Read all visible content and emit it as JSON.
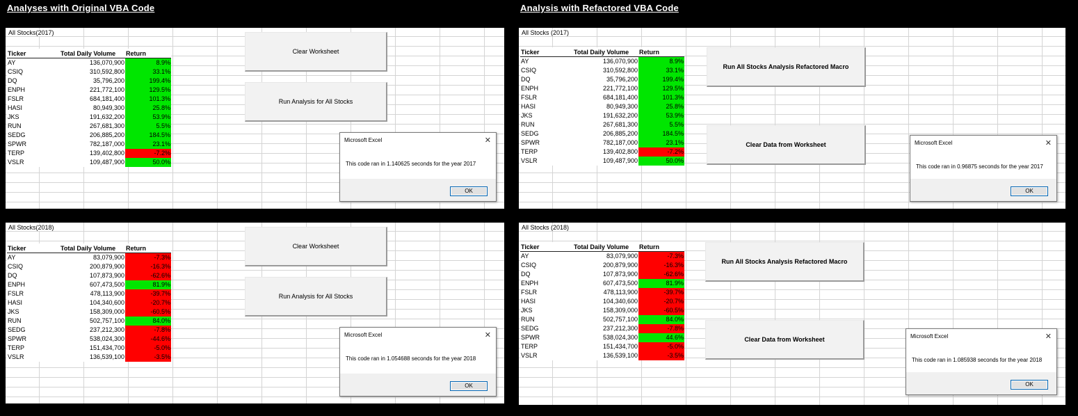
{
  "headings": {
    "original": "Analyses with Original VBA Code",
    "refactored": "Analysis with Refactored VBA Code"
  },
  "colors": {
    "positive": "#00e600",
    "negative": "#ff0000"
  },
  "panels": {
    "orig2017": {
      "title": "All Stocks(2017)",
      "headers": [
        "Ticker",
        "Total Daily Volume",
        "Return"
      ],
      "rows": [
        [
          "AY",
          "136,070,900",
          "8.9%"
        ],
        [
          "CSIQ",
          "310,592,800",
          "33.1%"
        ],
        [
          "DQ",
          "35,796,200",
          "199.4%"
        ],
        [
          "ENPH",
          "221,772,100",
          "129.5%"
        ],
        [
          "FSLR",
          "684,181,400",
          "101.3%"
        ],
        [
          "HASI",
          "80,949,300",
          "25.8%"
        ],
        [
          "JKS",
          "191,632,200",
          "53.9%"
        ],
        [
          "RUN",
          "267,681,300",
          "5.5%"
        ],
        [
          "SEDG",
          "206,885,200",
          "184.5%"
        ],
        [
          "SPWR",
          "782,187,000",
          "23.1%"
        ],
        [
          "TERP",
          "139,402,800",
          "-7.2%"
        ],
        [
          "VSLR",
          "109,487,900",
          "50.0%"
        ]
      ],
      "button1": "Clear Worksheet",
      "button2": "Run Analysis for All Stocks",
      "dialog": {
        "title": "Microsoft Excel",
        "message": "This code ran in 1.140625 seconds for the year 2017",
        "ok": "OK"
      }
    },
    "orig2018": {
      "title": "All Stocks(2018)",
      "headers": [
        "Ticker",
        "Total Daily Volume",
        "Return"
      ],
      "rows": [
        [
          "AY",
          "83,079,900",
          "-7.3%"
        ],
        [
          "CSIQ",
          "200,879,900",
          "-16.3%"
        ],
        [
          "DQ",
          "107,873,900",
          "-62.6%"
        ],
        [
          "ENPH",
          "607,473,500",
          "81.9%"
        ],
        [
          "FSLR",
          "478,113,900",
          "-39.7%"
        ],
        [
          "HASI",
          "104,340,600",
          "-20.7%"
        ],
        [
          "JKS",
          "158,309,000",
          "-60.5%"
        ],
        [
          "RUN",
          "502,757,100",
          "84.0%"
        ],
        [
          "SEDG",
          "237,212,300",
          "-7.8%"
        ],
        [
          "SPWR",
          "538,024,300",
          "-44.6%"
        ],
        [
          "TERP",
          "151,434,700",
          "-5.0%"
        ],
        [
          "VSLR",
          "136,539,100",
          "-3.5%"
        ]
      ],
      "button1": "Clear Worksheet",
      "button2": "Run Analysis for All Stocks",
      "dialog": {
        "title": "Microsoft Excel",
        "message": "This code ran in 1.054688 seconds for the year 2018",
        "ok": "OK"
      }
    },
    "ref2017": {
      "title": "All Stocks (2017)",
      "headers": [
        "Ticker",
        "Total Daily Volume",
        "Return"
      ],
      "rows": [
        [
          "AY",
          "136,070,900",
          "8.9%"
        ],
        [
          "CSIQ",
          "310,592,800",
          "33.1%"
        ],
        [
          "DQ",
          "35,796,200",
          "199.4%"
        ],
        [
          "ENPH",
          "221,772,100",
          "129.5%"
        ],
        [
          "FSLR",
          "684,181,400",
          "101.3%"
        ],
        [
          "HASI",
          "80,949,300",
          "25.8%"
        ],
        [
          "JKS",
          "191,632,200",
          "53.9%"
        ],
        [
          "RUN",
          "267,681,300",
          "5.5%"
        ],
        [
          "SEDG",
          "206,885,200",
          "184.5%"
        ],
        [
          "SPWR",
          "782,187,000",
          "23.1%"
        ],
        [
          "TERP",
          "139,402,800",
          "-7.2%"
        ],
        [
          "VSLR",
          "109,487,900",
          "50.0%"
        ]
      ],
      "button1": "Run All Stocks Analysis Refactored Macro",
      "button2": "Clear Data from Worksheet",
      "dialog": {
        "title": "Microsoft Excel",
        "message": "This code ran in 0.96875 seconds for the year 2017",
        "ok": "OK"
      }
    },
    "ref2018": {
      "title": "All Stocks (2018)",
      "headers": [
        "Ticker",
        "Total Daily Volume",
        "Return"
      ],
      "rows": [
        [
          "AY",
          "83,079,900",
          "-7.3%"
        ],
        [
          "CSIQ",
          "200,879,900",
          "-16.3%"
        ],
        [
          "DQ",
          "107,873,900",
          "-62.6%"
        ],
        [
          "ENPH",
          "607,473,500",
          "81.9%"
        ],
        [
          "FSLR",
          "478,113,900",
          "-39.7%"
        ],
        [
          "HASI",
          "104,340,600",
          "-20.7%"
        ],
        [
          "JKS",
          "158,309,000",
          "-60.5%"
        ],
        [
          "RUN",
          "502,757,100",
          "84.0%"
        ],
        [
          "SEDG",
          "237,212,300",
          "-7.8%"
        ],
        [
          "SPWR",
          "538,024,300",
          "44.6%"
        ],
        [
          "TERP",
          "151,434,700",
          "-5.0%"
        ],
        [
          "VSLR",
          "136,539,100",
          "-3.5%"
        ]
      ],
      "button1": "Run All Stocks Analysis Refactored Macro",
      "button2": "Clear Data from Worksheet",
      "dialog": {
        "title": "Microsoft Excel",
        "message": "This code ran in 1.085938 seconds for the year 2018",
        "ok": "OK"
      }
    }
  }
}
